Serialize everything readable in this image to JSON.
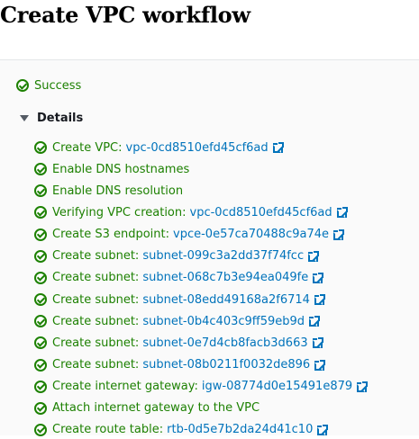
{
  "page": {
    "title": "Create VPC workflow"
  },
  "status": {
    "label": "Success",
    "icon": "success-check-icon",
    "color": "#1d8102"
  },
  "details": {
    "label": "Details",
    "expanded": true
  },
  "steps": [
    {
      "label": "Create VPC:",
      "link": "vpc-0cd8510efd45cf6ad"
    },
    {
      "label": "Enable DNS hostnames",
      "link": null
    },
    {
      "label": "Enable DNS resolution",
      "link": null
    },
    {
      "label": "Verifying VPC creation:",
      "link": "vpc-0cd8510efd45cf6ad"
    },
    {
      "label": "Create S3 endpoint:",
      "link": "vpce-0e57ca70488c9a74e"
    },
    {
      "label": "Create subnet:",
      "link": "subnet-099c3a2dd37f74fcc"
    },
    {
      "label": "Create subnet:",
      "link": "subnet-068c7b3e94ea049fe"
    },
    {
      "label": "Create subnet:",
      "link": "subnet-08edd49168a2f6714"
    },
    {
      "label": "Create subnet:",
      "link": "subnet-0b4c403c9ff59eb9d"
    },
    {
      "label": "Create subnet:",
      "link": "subnet-0e7d4cb8facb3d663"
    },
    {
      "label": "Create subnet:",
      "link": "subnet-08b0211f0032de896"
    },
    {
      "label": "Create internet gateway:",
      "link": "igw-08774d0e15491e879"
    },
    {
      "label": "Attach internet gateway to the VPC",
      "link": null
    },
    {
      "label": "Create route table:",
      "link": "rtb-0d5e7b2da24d41c10"
    }
  ],
  "colors": {
    "success": "#1d8102",
    "link": "#0073bb",
    "text": "#16191f"
  }
}
